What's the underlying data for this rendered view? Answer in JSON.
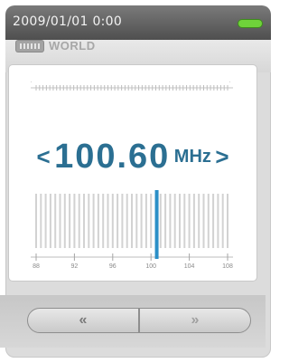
{
  "status": {
    "datetime": "2009/01/01   0:00"
  },
  "band": {
    "label": "WORLD"
  },
  "frequency": {
    "left_arrow": "<",
    "value": "100.60",
    "unit": "MHz",
    "right_arrow": ">"
  },
  "tuner": {
    "tick_labels": [
      "88",
      "92",
      "96",
      "100",
      "104",
      "108"
    ],
    "range": [
      88,
      108
    ],
    "current": 100.6
  },
  "controls": {
    "prev_label": "«",
    "next_label": "»"
  },
  "colors": {
    "accent": "#2b6f92",
    "battery": "#6fd23a"
  }
}
